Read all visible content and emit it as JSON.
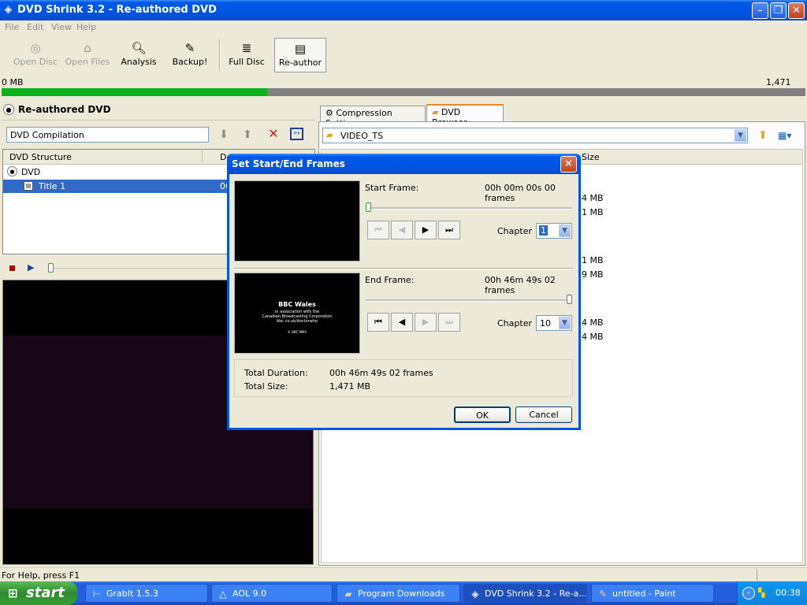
{
  "window": {
    "title": "DVD Shrink 3.2 - Re-authored DVD"
  },
  "menu": [
    "File",
    "Edit",
    "View",
    "Help"
  ],
  "toolbar": {
    "open_disc": "Open Disc",
    "open_files": "Open Files",
    "analysis": "Analysis",
    "backup": "Backup!",
    "full_disc": "Full Disc",
    "re_author": "Re-author"
  },
  "size": {
    "left": "0 MB",
    "right": "1,471 MB",
    "progress_fraction": 0.33
  },
  "left_panel": {
    "header": "Re-authored DVD",
    "compilation_name": "DVD Compilation",
    "structure_header": "DVD Structure",
    "col2_header": "D",
    "tree": [
      {
        "label": "DVD"
      },
      {
        "label": "Title 1",
        "value": "00"
      }
    ]
  },
  "tabs": {
    "compression": "Compression Settings",
    "browser": "DVD Browser"
  },
  "browser": {
    "path": "VIDEO_TS",
    "size_header": "Size",
    "sizes": [
      "4 MB",
      "1 MB",
      "1 MB",
      "9 MB",
      "4 MB",
      "4 MB"
    ]
  },
  "dialog": {
    "title": "Set Start/End Frames",
    "start_label": "Start Frame:",
    "start_value": "00h 00m 00s 00 frames",
    "start_chapter_label": "Chapter",
    "start_chapter": "1",
    "end_label": "End Frame:",
    "end_value": "00h 46m 49s 02 frames",
    "end_chapter_label": "Chapter",
    "end_chapter": "10",
    "preview": {
      "line1": "BBC Wales",
      "line2": "in association with the",
      "line3": "Canadian Broadcasting Corporation",
      "line4": "bbc.co.uk/doctorwho",
      "line5": "© BBC MMV"
    },
    "total_duration_label": "Total Duration:",
    "total_duration": "00h 46m 49s 02 frames",
    "total_size_label": "Total Size:",
    "total_size": "1,471 MB",
    "ok": "OK",
    "cancel": "Cancel"
  },
  "status": "For Help, press F1",
  "taskbar": {
    "start": "start",
    "items": [
      "GrabIt 1.5.3",
      "AOL 9.0",
      "Program Downloads",
      "DVD Shrink 3.2 - Re-a...",
      "untitled - Paint"
    ],
    "clock": "00:38"
  },
  "colors": {
    "progress": "#0cb21c",
    "selection": "#316ac5",
    "title_bar": "#0054e3"
  }
}
